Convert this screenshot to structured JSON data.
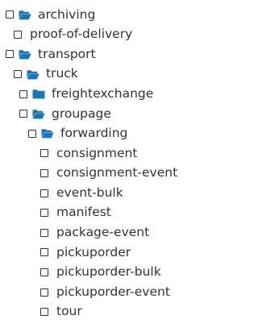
{
  "tree": [
    {
      "label": "archiving",
      "icon": "folder-open-icon",
      "depth": 0
    },
    {
      "label": "proof-of-delivery",
      "icon": null,
      "depth": 1
    },
    {
      "label": "transport",
      "icon": "folder-open-icon",
      "depth": 0
    },
    {
      "label": "truck",
      "icon": "folder-open-icon",
      "depth": 1
    },
    {
      "label": "freightexchange",
      "icon": "folder-closed-icon",
      "depth": 2
    },
    {
      "label": "groupage",
      "icon": "folder-open-icon",
      "depth": 2
    },
    {
      "label": "forwarding",
      "icon": "folder-open-icon",
      "depth": 3
    },
    {
      "label": "consignment",
      "icon": null,
      "depth": 4
    },
    {
      "label": "consignment-event",
      "icon": null,
      "depth": 4
    },
    {
      "label": "event-bulk",
      "icon": null,
      "depth": 4
    },
    {
      "label": "manifest",
      "icon": null,
      "depth": 4
    },
    {
      "label": "package-event",
      "icon": null,
      "depth": 4
    },
    {
      "label": "pickuporder",
      "icon": null,
      "depth": 4
    },
    {
      "label": "pickuporder-bulk",
      "icon": null,
      "depth": 4
    },
    {
      "label": "pickuporder-event",
      "icon": null,
      "depth": 4
    },
    {
      "label": "tour",
      "icon": null,
      "depth": 4
    }
  ],
  "colors": {
    "folder": "#1a74b8",
    "text": "#333333",
    "background": "#ffffff"
  }
}
